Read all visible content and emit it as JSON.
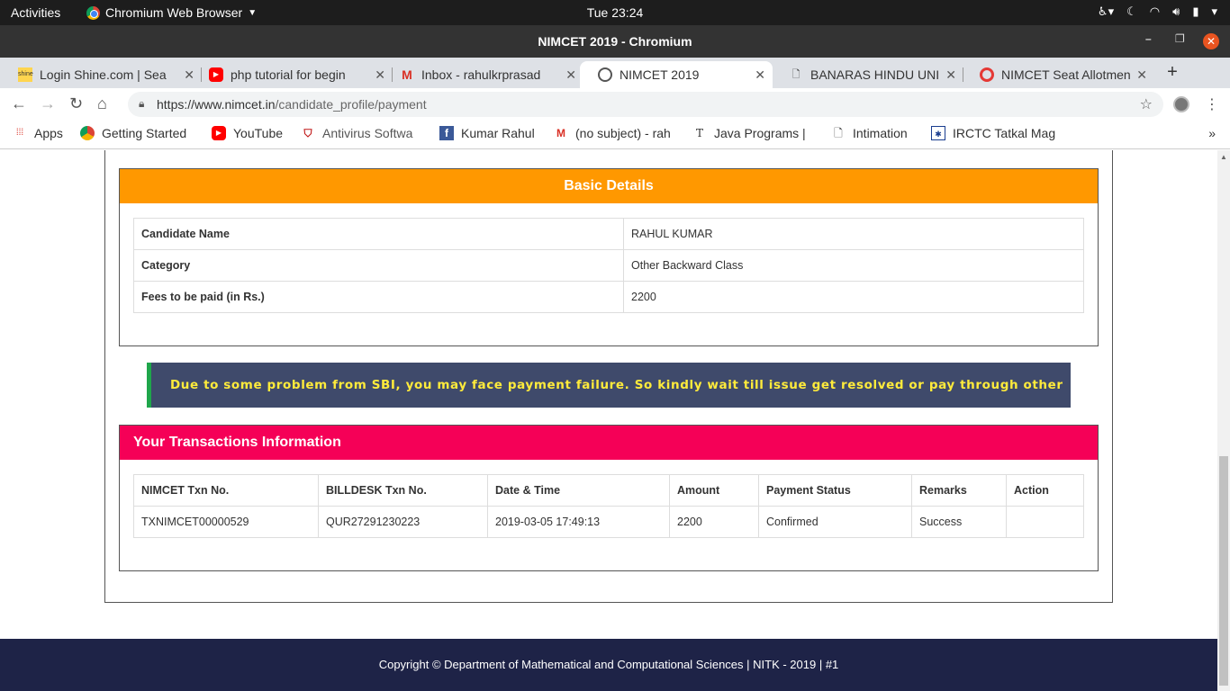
{
  "system_bar": {
    "activities": "Activities",
    "app_name": "Chromium Web Browser",
    "clock": "Tue 23:24"
  },
  "window": {
    "title": "NIMCET 2019 - Chromium"
  },
  "tabs": [
    {
      "label": "Login Shine.com | Sea",
      "icon": "shine-icon"
    },
    {
      "label": "php tutorial for begin",
      "icon": "youtube-icon"
    },
    {
      "label": "Inbox - rahulkrprasad",
      "icon": "gmail-icon"
    },
    {
      "label": "NIMCET 2019",
      "icon": "nimcet-icon"
    },
    {
      "label": "BANARAS HINDU UNI",
      "icon": "document-icon"
    },
    {
      "label": "NIMCET Seat Allotmen",
      "icon": "nimcet-red-icon"
    }
  ],
  "address_bar": {
    "url_host": "https://www.nimcet.in",
    "url_path": "/candidate_profile/payment"
  },
  "bookmarks": [
    {
      "label": "Apps",
      "icon": "apps-grid-icon"
    },
    {
      "label": "Getting Started",
      "icon": "chrome-icon"
    },
    {
      "label": "YouTube",
      "icon": "youtube-icon"
    },
    {
      "label": "Antivirus Softwa",
      "icon": "mcafee-icon"
    },
    {
      "label": "Kumar Rahul",
      "icon": "facebook-icon"
    },
    {
      "label": "(no subject) - rah",
      "icon": "gmail-icon"
    },
    {
      "label": "Java Programs |",
      "icon": "text-t-icon"
    },
    {
      "label": "Intimation",
      "icon": "document-icon"
    },
    {
      "label": "IRCTC Tatkal Mag",
      "icon": "irctc-icon"
    }
  ],
  "basic_details": {
    "heading": "Basic Details",
    "rows": [
      {
        "key": "Candidate Name",
        "value": "RAHUL KUMAR"
      },
      {
        "key": "Category",
        "value": "Other Backward Class"
      },
      {
        "key": "Fees to be paid (in Rs.)",
        "value": "2200"
      }
    ]
  },
  "notice": "Due to some problem from SBI, you may face payment failure. So kindly wait till issue get resolved or pay through other source..",
  "transactions": {
    "heading": "Your Transactions Information",
    "columns": [
      "NIMCET Txn No.",
      "BILLDESK Txn No.",
      "Date & Time",
      "Amount",
      "Payment Status",
      "Remarks",
      "Action"
    ],
    "rows": [
      [
        "TXNIMCET00000529",
        "QUR27291230223",
        "2019-03-05 17:49:13",
        "2200",
        "Confirmed",
        "Success",
        ""
      ]
    ]
  },
  "footer": "Copyright © Department of Mathematical and Computational Sciences | NITK - 2019 | #1",
  "colors": {
    "basic_header": "#ff9800",
    "txn_header": "#f50057",
    "notice_bg": "#3f4a6b",
    "notice_text": "#ffeb3b",
    "footer_bg": "#1e2347"
  }
}
